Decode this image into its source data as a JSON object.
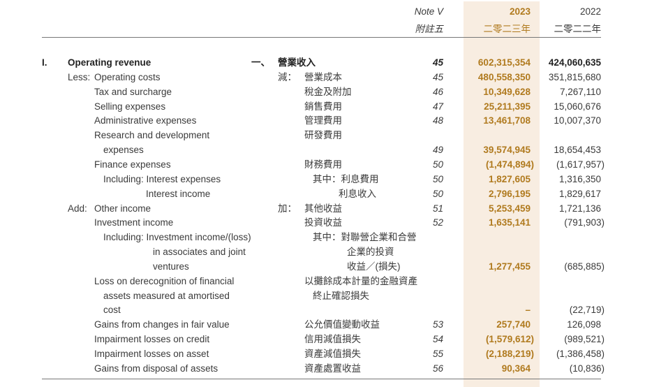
{
  "header": {
    "note_en": "Note V",
    "note_zh": "附註五",
    "y2023_en": "2023",
    "y2023_zh": "二零二三年",
    "y2022_en": "2022",
    "y2022_zh": "二零二二年"
  },
  "colors": {
    "accent": "#b07a1e",
    "highlight_column": "#f8ede1"
  },
  "rows": [
    {
      "mark_en": "I.",
      "label_en": "Operating revenue",
      "mark_zh": "一、",
      "label_zh": "營業收入",
      "note": "45",
      "y2023": "602,315,354",
      "y2022": "424,060,635",
      "bold": true
    },
    {
      "mark_en": "Less:",
      "label_en": "Operating costs",
      "mark_zh": "減：",
      "label_zh": "營業成本",
      "note": "45",
      "y2023": "480,558,350",
      "y2022": "351,815,680"
    },
    {
      "label_en": "Tax and surcharge",
      "label_zh": "稅金及附加",
      "note": "46",
      "y2023": "10,349,628",
      "y2022": "7,267,110"
    },
    {
      "label_en": "Selling expenses",
      "label_zh": "銷售費用",
      "note": "47",
      "y2023": "25,211,395",
      "y2022": "15,060,676"
    },
    {
      "label_en": "Administrative expenses",
      "label_zh": "管理費用",
      "note": "48",
      "y2023": "13,461,708",
      "y2022": "10,007,370"
    },
    {
      "label_en": "Research and development",
      "label_zh": "研發費用"
    },
    {
      "label_en": "expenses",
      "note": "49",
      "y2023": "39,574,945",
      "y2022": "18,654,453"
    },
    {
      "label_en": "Finance expenses",
      "label_zh": "財務費用",
      "note": "50",
      "y2023": "(1,474,894)",
      "y2022": "(1,617,957)"
    },
    {
      "label_en": "Including: Interest expenses",
      "label_zh": "其中：利息費用",
      "note": "50",
      "y2023": "1,827,605",
      "y2022": "1,316,350"
    },
    {
      "label_en": "Interest income",
      "label_zh": "利息收入",
      "note": "50",
      "y2023": "2,796,195",
      "y2022": "1,829,617"
    },
    {
      "mark_en": "Add:",
      "label_en": "Other income",
      "mark_zh": "加：",
      "label_zh": "其他收益",
      "note": "51",
      "y2023": "5,253,459",
      "y2022": "1,721,136"
    },
    {
      "label_en": "Investment income",
      "label_zh": "投資收益",
      "note": "52",
      "y2023": "1,635,141",
      "y2022": "(791,903)"
    },
    {
      "label_en": "Including: Investment income/(loss)",
      "label_zh": "其中：對聯營企業和合營"
    },
    {
      "label_en": "in associates and joint",
      "label_zh": "企業的投資"
    },
    {
      "label_en": "ventures",
      "label_zh": "收益／(損失)",
      "y2023": "1,277,455",
      "y2022": "(685,885)"
    },
    {
      "label_en": "Loss on derecognition of financial",
      "label_zh": "以攤餘成本計量的金融資產"
    },
    {
      "label_en": "assets measured at amortised",
      "label_zh": "終止確認損失"
    },
    {
      "label_en": "cost",
      "y2023": "–",
      "y2022": "(22,719)"
    },
    {
      "label_en": "Gains from changes in fair value",
      "label_zh": "公允價值變動收益",
      "note": "53",
      "y2023": "257,740",
      "y2022": "126,098"
    },
    {
      "label_en": "Impairment losses on credit",
      "label_zh": "信用減值損失",
      "note": "54",
      "y2023": "(1,579,612)",
      "y2022": "(989,521)"
    },
    {
      "label_en": "Impairment losses on asset",
      "label_zh": "資產減值損失",
      "note": "55",
      "y2023": "(2,188,219)",
      "y2022": "(1,386,458)"
    },
    {
      "label_en": "Gains from disposal of assets",
      "label_zh": "資產處置收益",
      "note": "56",
      "y2023": "90,364",
      "y2022": "(10,836)"
    }
  ]
}
